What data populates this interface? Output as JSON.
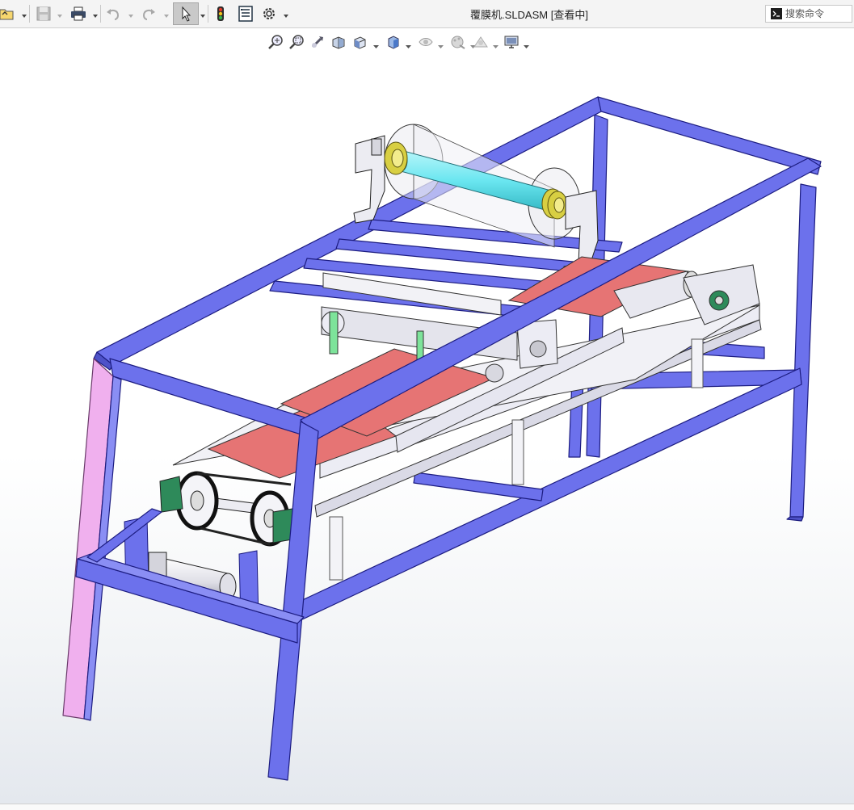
{
  "window": {
    "title": "覆膜机.SLDASM [查看中]"
  },
  "search": {
    "placeholder": "搜索命令"
  },
  "toolbar": {
    "items": [
      "open-icon",
      "save-icon",
      "print-icon",
      "undo-icon",
      "redo-icon",
      "select-icon",
      "rebuild-icon",
      "file-properties-icon",
      "options-icon"
    ]
  },
  "view_toolbar": {
    "items": [
      "zoom-to-fit-icon",
      "zoom-to-area-icon",
      "previous-view-icon",
      "section-view-icon",
      "view-orientation-icon",
      "display-style-icon",
      "hide-show-items-icon",
      "edit-appearance-icon",
      "apply-scene-icon",
      "view-settings-icon"
    ]
  },
  "colors": {
    "frame": "#6c71ec",
    "frame_edge": "#20208a",
    "frame_highlight": "#f0b0ee",
    "belt": "#e67474",
    "roller": "#6ae6f0",
    "flange": "#d8cf42",
    "bearing": "#2e8a5a",
    "parts": "#e6e6f0"
  }
}
